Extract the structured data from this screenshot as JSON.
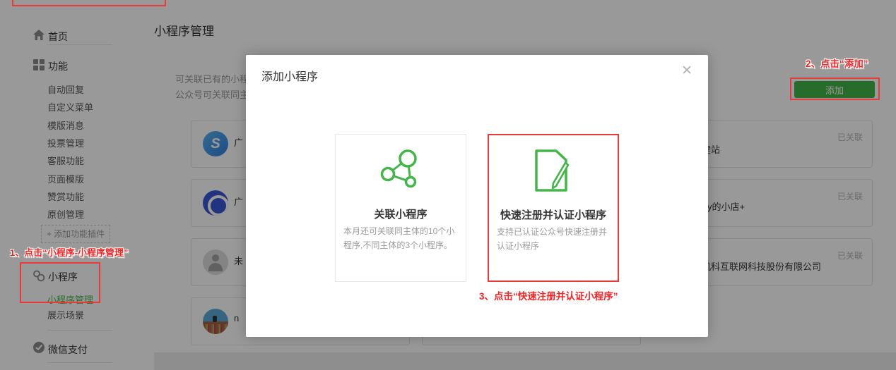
{
  "sidebar": {
    "home": "首页",
    "features": {
      "label": "功能",
      "items": [
        "自动回复",
        "自定义菜单",
        "模版消息",
        "投票管理",
        "客服功能",
        "页面模版",
        "赞赏功能",
        "原创管理"
      ]
    },
    "add_plugin": "+ 添加功能插件",
    "miniprogram": {
      "label": "小程序",
      "manage": "小程序管理",
      "scene": "展示场景"
    },
    "wechat_pay": "微信支付"
  },
  "page": {
    "title": "小程序管理",
    "desc_line1": "可关联已有的小程",
    "desc_line2": "公众号可关联同主",
    "add_button": "添加"
  },
  "list": {
    "status_label": "已关联",
    "partial_names": [
      "广",
      "广",
      "未",
      "n"
    ],
    "right_names": [
      "建站",
      "y的小店+",
      "机科互联网科技股份有限公司"
    ]
  },
  "modal": {
    "title": "添加小程序",
    "close": "✕",
    "cards": [
      {
        "title": "关联小程序",
        "desc": "本月还可关联同主体的10个小程序,不同主体的3个小程序。"
      },
      {
        "title": "快速注册并认证小程序",
        "desc": "支持已认证公众号快速注册并认证小程序"
      }
    ]
  },
  "annotations": {
    "step1": "1、点击“小程序-小程序管理”",
    "step2": "2、点击“添加”",
    "step3": "3、点击“快速注册并认证小程序”"
  },
  "colors": {
    "accent_green": "#44b549",
    "annotation_red": "#e83a3a",
    "overlay": "rgba(0,0,0,0.40)",
    "muted_text": "#9a9a9a",
    "dark_text": "#353535",
    "badge_gray": "#b2b2b2"
  }
}
